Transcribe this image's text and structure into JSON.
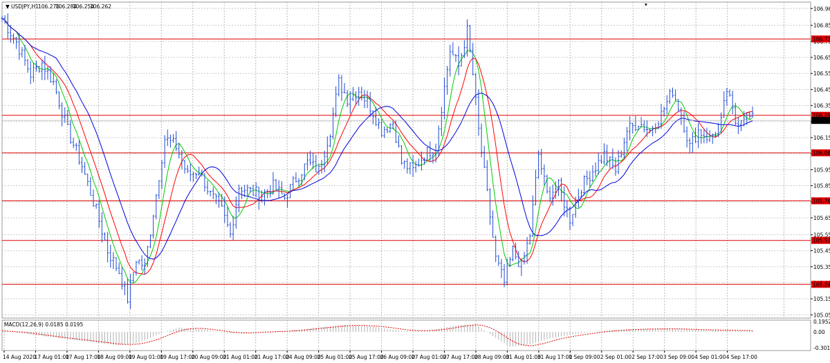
{
  "chart_data": {
    "type": "line",
    "symbol": "USDJPY",
    "timeframe": "H1",
    "title": "USDJPY,H1",
    "ohlc": {
      "open": "106.276",
      "high": "106.284",
      "low": "106.254",
      "close": "106.262"
    },
    "ylim": [
      105.03,
      107.0
    ],
    "grid": true,
    "y_ticks": [
      "106.960",
      "106.855",
      "106.755",
      "106.655",
      "106.555",
      "106.455",
      "106.355",
      "106.255",
      "106.155",
      "106.055",
      "105.955",
      "105.855",
      "105.755",
      "105.655",
      "105.550",
      "105.450",
      "105.350",
      "105.250",
      "105.150",
      "105.050"
    ],
    "x_labels": [
      "14 Aug 2020",
      "17 Aug 01:00",
      "17 Aug 17:00",
      "18 Aug 09:00",
      "19 Aug 01:00",
      "19 Aug 17:00",
      "20 Aug 09:00",
      "21 Aug 01:00",
      "21 Aug 17:00",
      "24 Aug 09:00",
      "25 Aug 01:00",
      "25 Aug 17:00",
      "26 Aug 09:00",
      "27 Aug 01:00",
      "27 Aug 17:00",
      "28 Aug 09:00",
      "31 Aug 01:00",
      "31 Aug 17:00",
      "1 Sep 09:00",
      "2 Sep 01:00",
      "2 Sep 17:00",
      "3 Sep 09:00",
      "4 Sep 01:00",
      "4 Sep 17:00"
    ],
    "levels": [
      {
        "label": "106.770",
        "value": 106.77
      },
      {
        "label": "106.294",
        "value": 106.294
      },
      {
        "label": "106.060",
        "value": 106.06
      },
      {
        "label": "105.761",
        "value": 105.761
      },
      {
        "label": "105.514",
        "value": 105.514
      },
      {
        "label": "105.240",
        "value": 105.24
      }
    ],
    "current_price": {
      "label": "106.262",
      "value": 106.262
    },
    "anchors": [
      {
        "x": 0,
        "y": 106.9
      },
      {
        "x": 5,
        "y": 106.75
      },
      {
        "x": 10,
        "y": 106.55
      },
      {
        "x": 14,
        "y": 106.62
      },
      {
        "x": 18,
        "y": 106.5
      },
      {
        "x": 23,
        "y": 106.2
      },
      {
        "x": 28,
        "y": 105.98
      },
      {
        "x": 33,
        "y": 105.7
      },
      {
        "x": 37,
        "y": 105.45
      },
      {
        "x": 41,
        "y": 105.32
      },
      {
        "x": 44,
        "y": 105.15
      },
      {
        "x": 47,
        "y": 105.4
      },
      {
        "x": 50,
        "y": 105.35
      },
      {
        "x": 54,
        "y": 105.8
      },
      {
        "x": 57,
        "y": 106.15
      },
      {
        "x": 61,
        "y": 106.1
      },
      {
        "x": 65,
        "y": 105.92
      },
      {
        "x": 69,
        "y": 105.95
      },
      {
        "x": 73,
        "y": 105.8
      },
      {
        "x": 77,
        "y": 105.7
      },
      {
        "x": 80,
        "y": 105.55
      },
      {
        "x": 83,
        "y": 105.85
      },
      {
        "x": 87,
        "y": 105.82
      },
      {
        "x": 91,
        "y": 105.8
      },
      {
        "x": 95,
        "y": 105.85
      },
      {
        "x": 99,
        "y": 105.78
      },
      {
        "x": 103,
        "y": 105.9
      },
      {
        "x": 107,
        "y": 106.0
      },
      {
        "x": 111,
        "y": 105.95
      },
      {
        "x": 115,
        "y": 106.2
      },
      {
        "x": 118,
        "y": 106.5
      },
      {
        "x": 121,
        "y": 106.4
      },
      {
        "x": 125,
        "y": 106.45
      },
      {
        "x": 129,
        "y": 106.35
      },
      {
        "x": 133,
        "y": 106.2
      },
      {
        "x": 137,
        "y": 106.25
      },
      {
        "x": 140,
        "y": 106.0
      },
      {
        "x": 144,
        "y": 105.95
      },
      {
        "x": 148,
        "y": 106.05
      },
      {
        "x": 152,
        "y": 106.1
      },
      {
        "x": 154,
        "y": 106.35
      },
      {
        "x": 157,
        "y": 106.7
      },
      {
        "x": 160,
        "y": 106.6
      },
      {
        "x": 163,
        "y": 106.82
      },
      {
        "x": 165,
        "y": 106.55
      },
      {
        "x": 167,
        "y": 106.2
      },
      {
        "x": 170,
        "y": 105.8
      },
      {
        "x": 173,
        "y": 105.4
      },
      {
        "x": 176,
        "y": 105.25
      },
      {
        "x": 179,
        "y": 105.45
      },
      {
        "x": 182,
        "y": 105.35
      },
      {
        "x": 185,
        "y": 105.55
      },
      {
        "x": 188,
        "y": 106.05
      },
      {
        "x": 191,
        "y": 105.8
      },
      {
        "x": 195,
        "y": 105.85
      },
      {
        "x": 199,
        "y": 105.65
      },
      {
        "x": 203,
        "y": 105.85
      },
      {
        "x": 207,
        "y": 105.95
      },
      {
        "x": 211,
        "y": 106.05
      },
      {
        "x": 215,
        "y": 105.95
      },
      {
        "x": 219,
        "y": 106.2
      },
      {
        "x": 223,
        "y": 106.25
      },
      {
        "x": 227,
        "y": 106.2
      },
      {
        "x": 231,
        "y": 106.3
      },
      {
        "x": 235,
        "y": 106.45
      },
      {
        "x": 238,
        "y": 106.3
      },
      {
        "x": 241,
        "y": 106.1
      },
      {
        "x": 244,
        "y": 106.2
      },
      {
        "x": 248,
        "y": 106.15
      },
      {
        "x": 252,
        "y": 106.25
      },
      {
        "x": 254,
        "y": 106.45
      },
      {
        "x": 257,
        "y": 106.25
      },
      {
        "x": 260,
        "y": 106.3
      },
      {
        "x": 263,
        "y": 106.27
      }
    ],
    "x_range": [
      0,
      290
    ],
    "macd": {
      "label": "MACD(12,26,9) 0.0185 0.0195",
      "y_ticks": [
        "0.1952",
        "0.00",
        "-0.3014"
      ],
      "ylim": [
        -0.35,
        0.22
      ],
      "anchors": [
        {
          "x": 0,
          "y": 0.02
        },
        {
          "x": 10,
          "y": -0.05
        },
        {
          "x": 20,
          "y": -0.12
        },
        {
          "x": 30,
          "y": -0.18
        },
        {
          "x": 40,
          "y": -0.25
        },
        {
          "x": 48,
          "y": -0.2
        },
        {
          "x": 56,
          "y": -0.02
        },
        {
          "x": 62,
          "y": 0.08
        },
        {
          "x": 70,
          "y": 0.05
        },
        {
          "x": 80,
          "y": -0.03
        },
        {
          "x": 90,
          "y": 0.0
        },
        {
          "x": 100,
          "y": 0.02
        },
        {
          "x": 110,
          "y": 0.08
        },
        {
          "x": 120,
          "y": 0.13
        },
        {
          "x": 130,
          "y": 0.1
        },
        {
          "x": 140,
          "y": 0.02
        },
        {
          "x": 150,
          "y": 0.03
        },
        {
          "x": 160,
          "y": 0.13
        },
        {
          "x": 166,
          "y": 0.14
        },
        {
          "x": 172,
          "y": -0.08
        },
        {
          "x": 178,
          "y": -0.28
        },
        {
          "x": 184,
          "y": -0.25
        },
        {
          "x": 192,
          "y": -0.12
        },
        {
          "x": 200,
          "y": -0.05
        },
        {
          "x": 210,
          "y": 0.02
        },
        {
          "x": 220,
          "y": 0.05
        },
        {
          "x": 232,
          "y": 0.06
        },
        {
          "x": 242,
          "y": 0.04
        },
        {
          "x": 252,
          "y": 0.03
        },
        {
          "x": 263,
          "y": 0.02
        }
      ]
    },
    "colors": {
      "price": "#1f4bd4",
      "ma_fast": "#00cc00",
      "ma_mid": "#ff0000",
      "ma_slow": "#0000dd",
      "levels": "#e00000",
      "level_tag": "#e00000",
      "current_tag": "#000000",
      "macd_hist": "#b0b0b0",
      "macd_signal": "#e00000"
    }
  }
}
